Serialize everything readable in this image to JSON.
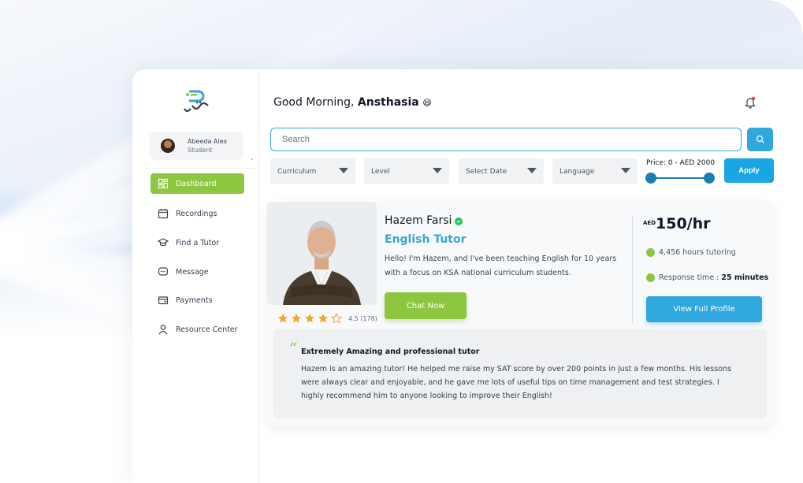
{
  "sidebar": {
    "user": {
      "name": "Abeeda Alex",
      "role": "Student"
    },
    "items": [
      {
        "label": "Dashboard",
        "icon": "dashboard-icon",
        "active": true
      },
      {
        "label": "Recordings",
        "icon": "calendar-icon",
        "active": false
      },
      {
        "label": "Find a Tutor",
        "icon": "graduation-cap-icon",
        "active": false
      },
      {
        "label": "Message",
        "icon": "chat-icon",
        "active": false
      },
      {
        "label": "Payments",
        "icon": "wallet-icon",
        "active": false
      },
      {
        "label": "Resource Center",
        "icon": "person-icon",
        "active": false
      }
    ]
  },
  "header": {
    "greeting": "Good Morning, ",
    "user_name": "Ansthasia",
    "emoji": "😄"
  },
  "search": {
    "placeholder": "Search"
  },
  "filters": {
    "curriculum": "Curriculum",
    "level": "Level",
    "date": "Select Date",
    "language": "Language",
    "price_label": "Price: 0 - AED 2000",
    "price_min_fraction": 0,
    "price_max_fraction": 1,
    "apply_label": "Apply"
  },
  "tutor": {
    "name": "Hazem Farsi",
    "role": "English Tutor",
    "bio": "Hello! I'm Hazem, and I've been teaching English for 10 years with a focus on KSA national curriculum students.",
    "chat_label": "Chat Now",
    "rating_stars": 4,
    "rating_text": "4.5 (178)",
    "currency": "AED",
    "price": "150/hr",
    "hours": "4,456 hours tutoring",
    "response_label": "Response time :",
    "response_value": "25 minutes",
    "profile_label": "View Full Profile"
  },
  "review": {
    "title": "Extremely Amazing and professional tutor",
    "body": "Hazem is an amazing tutor! He helped me raise my SAT score by over 200 points in just a few months. His lessons were always clear and enjoyable, and he gave me lots of useful tips on time management and test strategies. I highly recommend him to anyone looking to improve their English!"
  },
  "colors": {
    "accent_green": "#8dc63f",
    "accent_blue": "#30a7dd",
    "slider_blue": "#1b7fb3"
  }
}
